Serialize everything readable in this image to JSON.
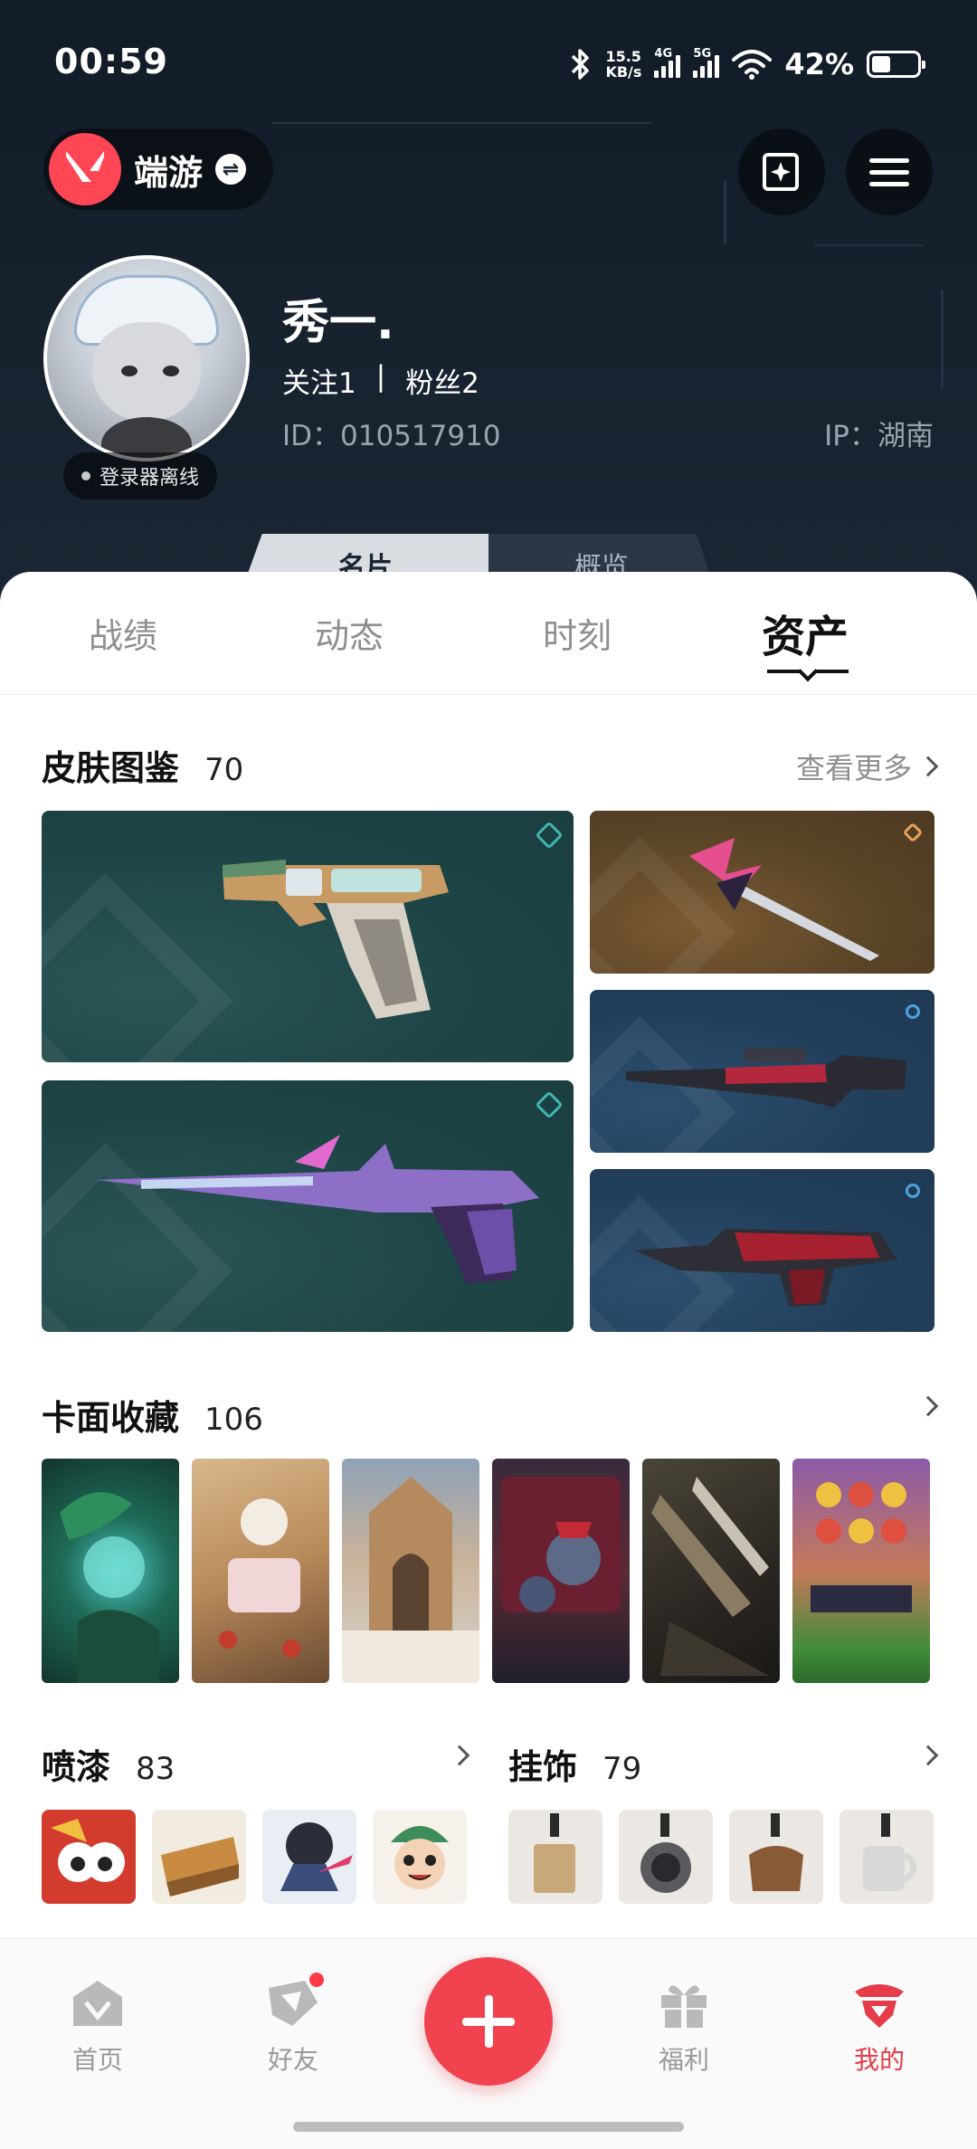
{
  "status_bar": {
    "time": "00:59",
    "net_speed_value": "15.5",
    "net_speed_unit": "KB/s",
    "signal1_tag": "4G",
    "signal2_tag": "5G",
    "battery_pct": "42%",
    "battery_level": 0.42
  },
  "header": {
    "game_name": "端游",
    "nickname": "秀一.",
    "follow": "关注1",
    "separator": "|",
    "fans": "粉丝2",
    "id_text": "ID：010517910",
    "ip_text": "IP：湖南",
    "login_status": "登录器离线",
    "subtabs": [
      "名片",
      "概览"
    ]
  },
  "tabs": {
    "items": [
      "战绩",
      "动态",
      "时刻",
      "资产"
    ],
    "active": "资产"
  },
  "skins": {
    "title": "皮肤图鉴",
    "count": "70",
    "more": "查看更多"
  },
  "cards": {
    "title": "卡面收藏",
    "count": "106"
  },
  "sprays": {
    "title": "喷漆",
    "count": "83"
  },
  "charms": {
    "title": "挂饰",
    "count": "79"
  },
  "bottom_nav": {
    "items": [
      "首页",
      "好友",
      "福利",
      "我的"
    ],
    "active": "我的"
  },
  "colors": {
    "accent": "#f0434f",
    "header_bg": "#17222f",
    "active_nav": "#e63b48"
  }
}
